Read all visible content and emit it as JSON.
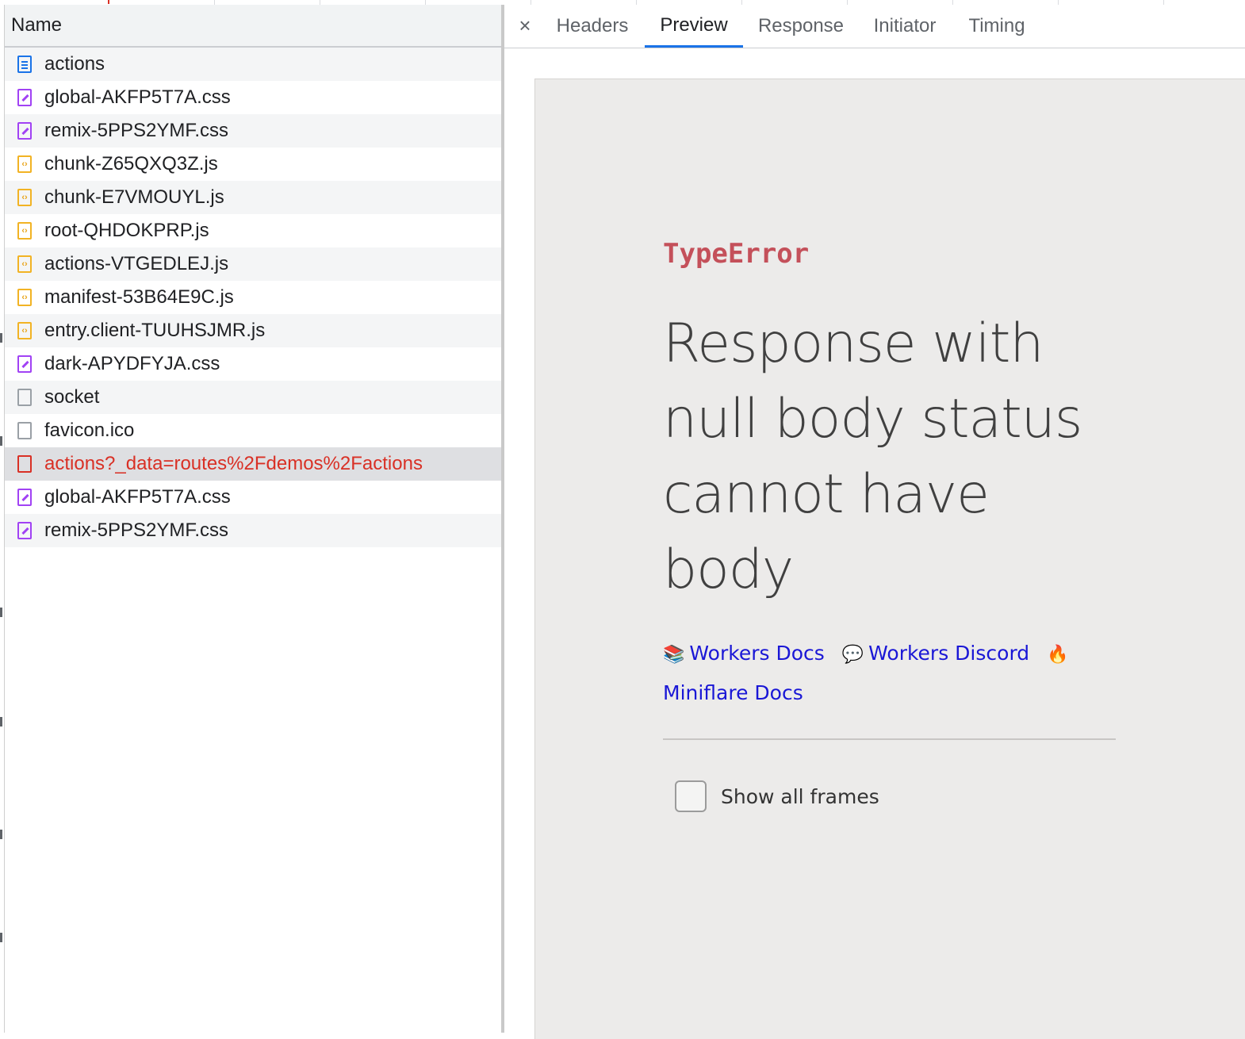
{
  "name_panel": {
    "column_header": "Name",
    "requests": [
      {
        "name": "actions",
        "type": "document-icon"
      },
      {
        "name": "global-AKFP5T7A.css",
        "type": "stylesheet-icon"
      },
      {
        "name": "remix-5PPS2YMF.css",
        "type": "stylesheet-icon"
      },
      {
        "name": "chunk-Z65QXQ3Z.js",
        "type": "script-icon"
      },
      {
        "name": "chunk-E7VMOUYL.js",
        "type": "script-icon"
      },
      {
        "name": "root-QHDOKPRP.js",
        "type": "script-icon"
      },
      {
        "name": "actions-VTGEDLEJ.js",
        "type": "script-icon"
      },
      {
        "name": "manifest-53B64E9C.js",
        "type": "script-icon"
      },
      {
        "name": "entry.client-TUUHSJMR.js",
        "type": "script-icon"
      },
      {
        "name": "dark-APYDFYJA.css",
        "type": "stylesheet-icon"
      },
      {
        "name": "socket",
        "type": "file-icon"
      },
      {
        "name": "favicon.ico",
        "type": "file-icon"
      },
      {
        "name": "actions?_data=routes%2Fdemos%2Factions",
        "type": "error-file-icon",
        "status": "error",
        "selected": true
      },
      {
        "name": "global-AKFP5T7A.css",
        "type": "stylesheet-icon"
      },
      {
        "name": "remix-5PPS2YMF.css",
        "type": "stylesheet-icon"
      }
    ]
  },
  "details_panel": {
    "close_glyph": "×",
    "tabs": [
      {
        "label": "Headers"
      },
      {
        "label": "Preview",
        "active": true
      },
      {
        "label": "Response"
      },
      {
        "label": "Initiator"
      },
      {
        "label": "Timing"
      }
    ]
  },
  "preview": {
    "error_type": "TypeError",
    "error_message": "Response with null body status cannot have body",
    "links": [
      {
        "emoji": "📚",
        "emoji_name": "books-icon",
        "label": "Workers Docs"
      },
      {
        "emoji": "💬",
        "emoji_name": "speech-bubble-icon",
        "label": "Workers Discord"
      },
      {
        "emoji": "🔥",
        "emoji_name": "fire-icon",
        "label": "Miniflare Docs"
      }
    ],
    "show_frames_label": "Show all frames",
    "show_frames_checked": false
  },
  "colors": {
    "accent": "#1a73e8",
    "error_text": "#d93025",
    "error_type": "#c4505a",
    "link": "#1a17d6",
    "preview_background": "#ecebea"
  }
}
